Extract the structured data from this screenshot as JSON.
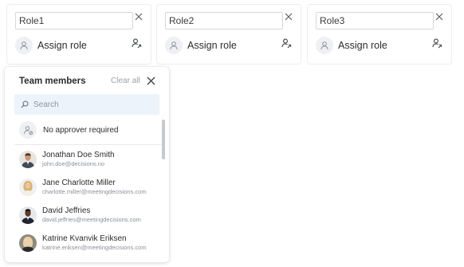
{
  "roles": [
    {
      "value": "Role1",
      "assign_label": "Assign role"
    },
    {
      "value": "Role2",
      "assign_label": "Assign role"
    },
    {
      "value": "Role3",
      "assign_label": "Assign role"
    }
  ],
  "dropdown": {
    "title": "Team members",
    "clear_label": "Clear all",
    "search_placeholder": "Search",
    "no_approver_label": "No approver required",
    "members": [
      {
        "name": "Jonathan Doe Smith",
        "email": "john.doe@decisions.no"
      },
      {
        "name": "Jane Charlotte Miller",
        "email": "charlotte.miller@meetingdecisions.com"
      },
      {
        "name": "David Jeffries",
        "email": "david.jeffries@meetingdecisions.com"
      },
      {
        "name": "Katrine Kvanvik Eriksen",
        "email": "katrine.eriksen@meetingdecisions.com"
      }
    ]
  },
  "icons": {
    "close": "close-icon",
    "person": "person-icon",
    "assign": "assign-person-icon",
    "search": "search-icon",
    "no_approver": "person-blocked-icon"
  },
  "colors": {
    "card_border": "#eceef2",
    "search_bg": "#edf3fb",
    "muted_text": "#9aa0a8"
  }
}
